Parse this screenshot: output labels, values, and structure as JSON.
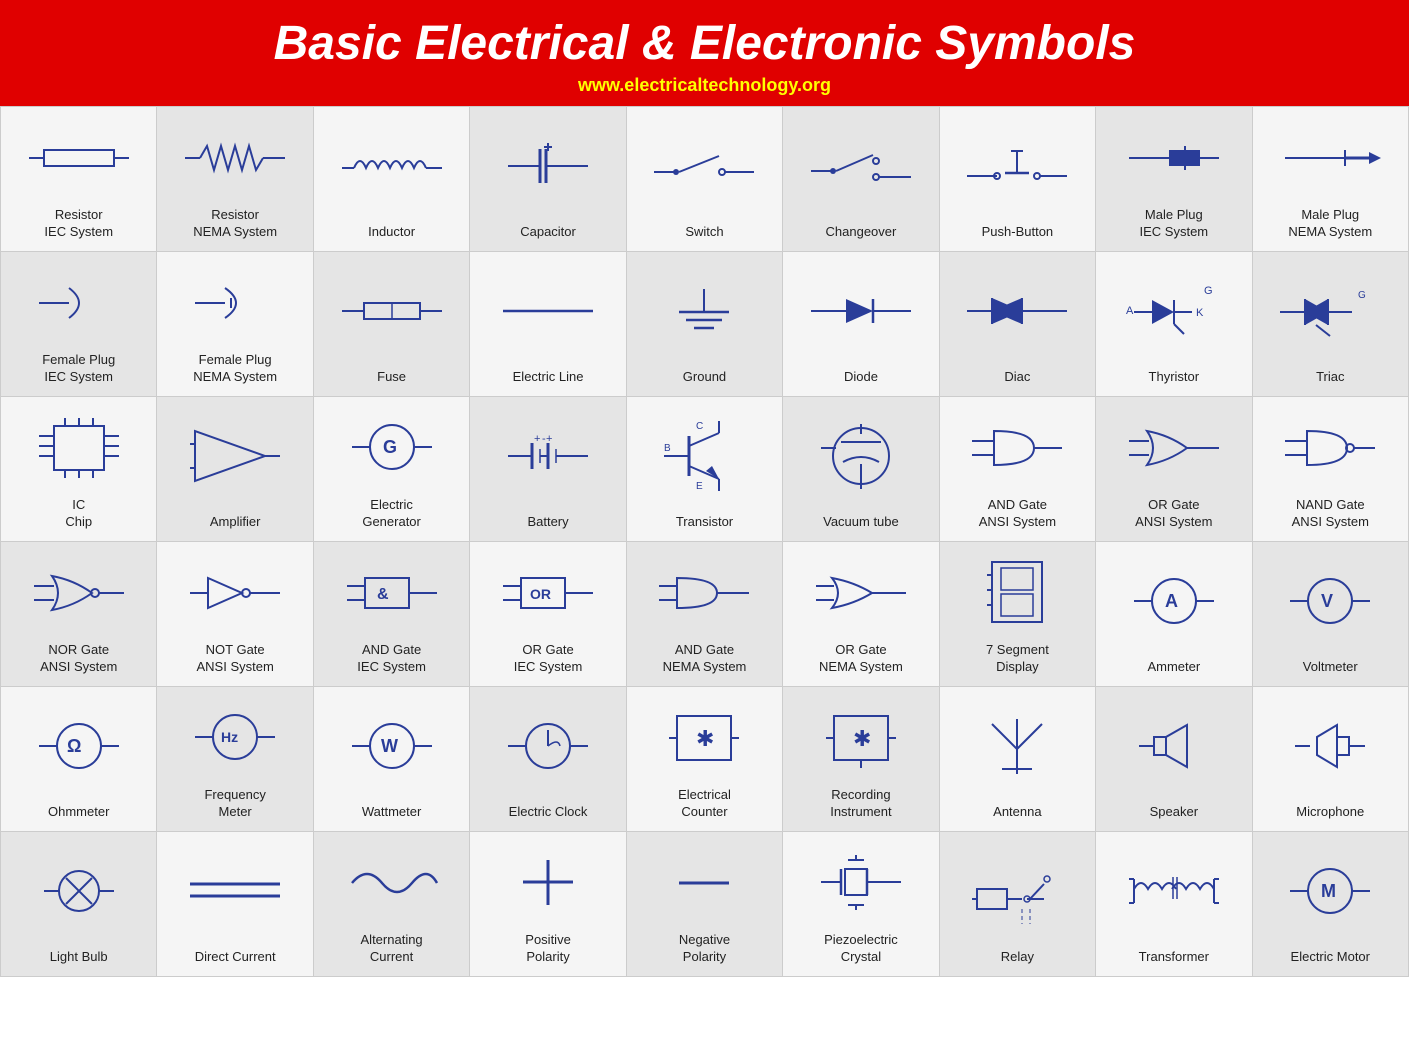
{
  "header": {
    "title": "Basic Electrical & Electronic Symbols",
    "website": "www.electricaltechnology.org"
  },
  "cells": [
    {
      "id": "resistor-iec",
      "label": "Resistor\nIEC System"
    },
    {
      "id": "resistor-nema",
      "label": "Resistor\nNEMA System"
    },
    {
      "id": "inductor",
      "label": "Inductor"
    },
    {
      "id": "capacitor",
      "label": "Capacitor"
    },
    {
      "id": "switch",
      "label": "Switch"
    },
    {
      "id": "changeover",
      "label": "Changeover"
    },
    {
      "id": "push-button",
      "label": "Push-Button"
    },
    {
      "id": "male-plug-iec",
      "label": "Male Plug\nIEC System"
    },
    {
      "id": "male-plug-nema",
      "label": "Male Plug\nNEMA System"
    },
    {
      "id": "female-plug-iec",
      "label": "Female Plug\nIEC System"
    },
    {
      "id": "female-plug-nema",
      "label": "Female Plug\nNEMA System"
    },
    {
      "id": "fuse",
      "label": "Fuse"
    },
    {
      "id": "electric-line",
      "label": "Electric Line"
    },
    {
      "id": "ground",
      "label": "Ground"
    },
    {
      "id": "diode",
      "label": "Diode"
    },
    {
      "id": "diac",
      "label": "Diac"
    },
    {
      "id": "thyristor",
      "label": "Thyristor"
    },
    {
      "id": "triac",
      "label": "Triac"
    },
    {
      "id": "ic-chip",
      "label": "IC\nChip"
    },
    {
      "id": "amplifier",
      "label": "Amplifier"
    },
    {
      "id": "electric-generator",
      "label": "Electric\nGenerator"
    },
    {
      "id": "battery",
      "label": "Battery"
    },
    {
      "id": "transistor",
      "label": "Transistor"
    },
    {
      "id": "vacuum-tube",
      "label": "Vacuum tube"
    },
    {
      "id": "and-gate-ansi",
      "label": "AND Gate\nANSI System"
    },
    {
      "id": "or-gate-ansi",
      "label": "OR Gate\nANSI System"
    },
    {
      "id": "nand-gate-ansi",
      "label": "NAND Gate\nANSI System"
    },
    {
      "id": "nor-gate-ansi",
      "label": "NOR Gate\nANSI System"
    },
    {
      "id": "not-gate-ansi",
      "label": "NOT Gate\nANSI System"
    },
    {
      "id": "and-gate-iec",
      "label": "AND Gate\nIEC System"
    },
    {
      "id": "or-gate-iec",
      "label": "OR Gate\nIEC System"
    },
    {
      "id": "and-gate-nema",
      "label": "AND Gate\nNEMA System"
    },
    {
      "id": "or-gate-nema",
      "label": "OR Gate\nNEMA System"
    },
    {
      "id": "7-segment-display",
      "label": "7 Segment\nDisplay"
    },
    {
      "id": "ammeter",
      "label": "Ammeter"
    },
    {
      "id": "voltmeter",
      "label": "Voltmeter"
    },
    {
      "id": "ohmmeter",
      "label": "Ohmmeter"
    },
    {
      "id": "frequency-meter",
      "label": "Frequency\nMeter"
    },
    {
      "id": "wattmeter",
      "label": "Wattmeter"
    },
    {
      "id": "electric-clock",
      "label": "Electric Clock"
    },
    {
      "id": "electrical-counter",
      "label": "Electrical\nCounter"
    },
    {
      "id": "recording-instrument",
      "label": "Recording\nInstrument"
    },
    {
      "id": "antenna",
      "label": "Antenna"
    },
    {
      "id": "speaker",
      "label": "Speaker"
    },
    {
      "id": "microphone",
      "label": "Microphone"
    },
    {
      "id": "light-bulb",
      "label": "Light Bulb"
    },
    {
      "id": "direct-current",
      "label": "Direct Current"
    },
    {
      "id": "alternating-current",
      "label": "Alternating\nCurrent"
    },
    {
      "id": "positive-polarity",
      "label": "Positive\nPolarity"
    },
    {
      "id": "negative-polarity",
      "label": "Negative\nPolarity"
    },
    {
      "id": "piezoelectric-crystal",
      "label": "Piezoelectric\nCrystal"
    },
    {
      "id": "relay",
      "label": "Relay"
    },
    {
      "id": "transformer",
      "label": "Transformer"
    },
    {
      "id": "electric-motor",
      "label": "Electric Motor"
    }
  ]
}
